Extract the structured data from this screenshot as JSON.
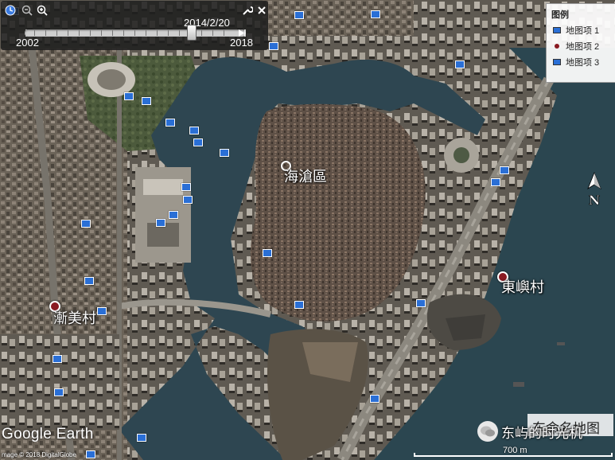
{
  "timebar": {
    "date": "2014/2/20",
    "start_year": "2002",
    "end_year": "2018",
    "position_fraction": 0.75
  },
  "legend": {
    "title": "图例",
    "items": [
      {
        "label": "地图项 1",
        "icon": "photo-icon"
      },
      {
        "label": "地图项 2",
        "icon": "pin-icon"
      },
      {
        "label": "地图项 3",
        "icon": "photo-icon"
      }
    ]
  },
  "places": {
    "haicang": "海滄區",
    "dongyu": "東嶼村",
    "jianmei": "漸美村"
  },
  "branding": {
    "logo": "Google Earth",
    "copyright": "mage © 2018 DigitalGlobe",
    "watermark": "东屿的时光机",
    "stamp": "东命名地图"
  },
  "scale": {
    "label": "700 m"
  },
  "compass": {
    "label": "N"
  },
  "colors": {
    "water": "#2e4651",
    "land": "#5a5246",
    "pin": "#8a1a22",
    "photo": "#2a6fd6"
  }
}
